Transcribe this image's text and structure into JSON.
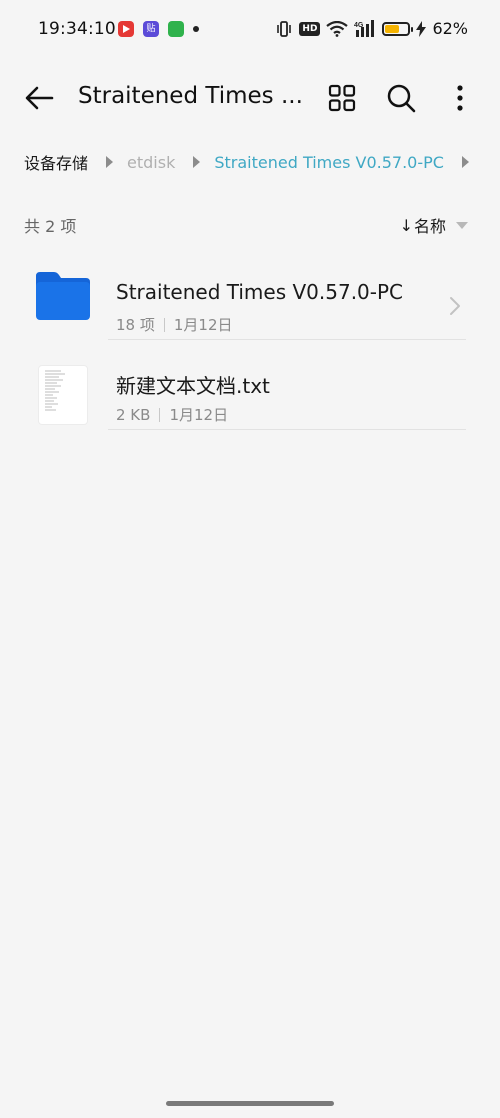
{
  "status_bar": {
    "time": "19:34:10",
    "hd_label": "HD",
    "network_label": "4G",
    "battery_percent": "62%",
    "battery_level": 0.62,
    "notif_purple_text": "贴",
    "icons": [
      "app-red-play-icon",
      "app-purple-icon",
      "app-green-icon",
      "notification-dot-icon",
      "vibrate-icon",
      "hd-icon",
      "wifi-icon",
      "signal-icon",
      "battery-icon",
      "charging-bolt-icon"
    ]
  },
  "app_bar": {
    "title": "Straitened Times ...",
    "icons": [
      "back-arrow-icon",
      "grid-view-icon",
      "search-icon",
      "more-vertical-icon"
    ]
  },
  "breadcrumb": {
    "items": [
      {
        "label": "设备存储"
      },
      {
        "label": "etdisk"
      },
      {
        "label": "Straitened Times V0.57.0-PC"
      }
    ]
  },
  "list_header": {
    "count": "共 2 项",
    "sort_arrow": "↓",
    "sort_label": "名称"
  },
  "files": [
    {
      "name": "Straitened Times V0.57.0-PC",
      "meta_items": "18 项",
      "meta_date": "1月12日",
      "type": "folder",
      "icon": "folder-icon"
    },
    {
      "name": "新建文本文档.txt",
      "meta_size": "2 KB",
      "meta_date": "1月12日",
      "type": "text",
      "icon": "text-file-thumbnail-icon"
    }
  ],
  "colors": {
    "background": "#f5f5f5",
    "accent": "#3fa8c4",
    "folder": "#1a73e8",
    "battery": "#f5b300"
  }
}
